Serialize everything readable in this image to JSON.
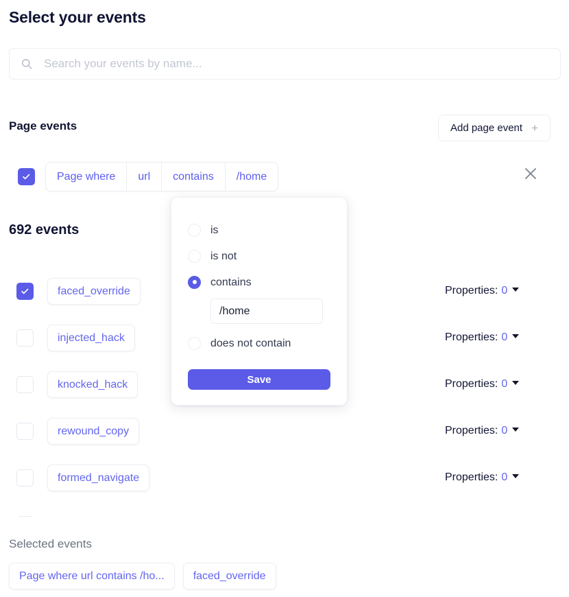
{
  "colors": {
    "accent": "#5b5be8",
    "link": "#6365ef",
    "heading": "#111433",
    "muted": "#6b7280",
    "border": "#eceef3"
  },
  "header": {
    "title": "Select your events"
  },
  "search": {
    "placeholder": "Search your events by name...",
    "value": "",
    "icon": "search-icon"
  },
  "page_events": {
    "section_label": "Page events",
    "add_button_label": "Add page event",
    "add_button_icon": "plus-icon",
    "remove_icon": "close-icon",
    "filter": {
      "checked": true,
      "segments": [
        "Page where",
        "url",
        "contains",
        "/home"
      ]
    }
  },
  "condition_popup": {
    "options": [
      {
        "label": "is",
        "selected": false
      },
      {
        "label": "is not",
        "selected": false
      },
      {
        "label": "contains",
        "selected": true
      },
      {
        "label": "does not contain",
        "selected": false
      }
    ],
    "input_value": "/home",
    "save_label": "Save"
  },
  "events_list": {
    "count_label": "692 events",
    "properties_label": "Properties:",
    "properties_caret_icon": "chevron-down-icon",
    "rows": [
      {
        "name": "faced_override",
        "checked": true,
        "properties": "0"
      },
      {
        "name": "injected_hack",
        "checked": false,
        "properties": "0"
      },
      {
        "name": "knocked_hack",
        "checked": false,
        "properties": "0"
      },
      {
        "name": "rewound_copy",
        "checked": false,
        "properties": "0"
      },
      {
        "name": "formed_navigate",
        "checked": false,
        "properties": "0"
      },
      {
        "name": "",
        "checked": false,
        "properties": ""
      }
    ]
  },
  "selected_events": {
    "label": "Selected events",
    "chips": [
      "Page where url contains /ho...",
      "faced_override"
    ]
  }
}
